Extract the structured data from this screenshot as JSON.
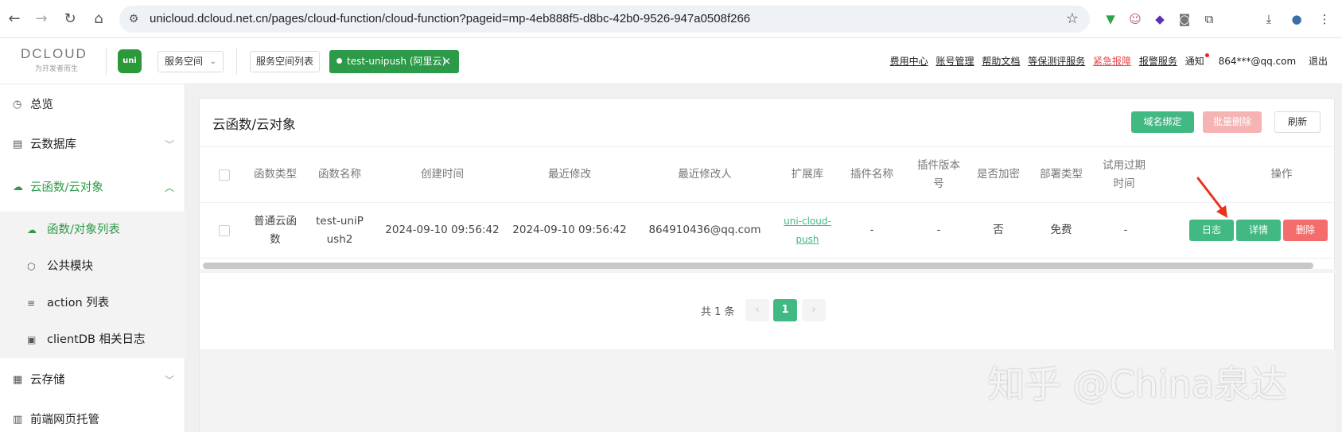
{
  "browser": {
    "url": "unicloud.dcloud.net.cn/pages/cloud-function/cloud-function?pageid=mp-4eb888f5-d8bc-42b0-9526-947a0508f266",
    "icons": [
      "back-icon",
      "forward-icon",
      "reload-icon",
      "home-icon",
      "site-info-icon",
      "star-icon",
      "extensions-icon",
      "download-icon",
      "profile-icon",
      "menu-icon"
    ]
  },
  "header": {
    "logo_text": "DCLOUD",
    "logo_sub": "为开发者而生",
    "uni_logo": "uni",
    "space_select": "服务空间",
    "space_list_btn": "服务空间列表",
    "active_space": "test-unipush (阿里云)",
    "links": {
      "fee": "费用中心",
      "account": "账号管理",
      "help": "帮助文档",
      "security": "等保测评服务",
      "emergency": "紧急报障",
      "alarm": "报警服务",
      "notice": "通知",
      "user": "864***@qq.com",
      "logout": "退出"
    }
  },
  "sidebar": {
    "overview": "总览",
    "database": "云数据库",
    "cloud_function": "云函数/云对象",
    "sub_items": [
      "函数/对象列表",
      "公共模块",
      "action 列表",
      "clientDB 相关日志"
    ],
    "storage": "云存储",
    "hosting": "前端网页托管"
  },
  "main": {
    "title": "云函数/云对象",
    "btn_domain": "域名绑定",
    "btn_batch_delete": "批量删除",
    "btn_refresh": "刷新",
    "columns": [
      "函数类型",
      "函数名称",
      "创建时间",
      "最近修改",
      "最近修改人",
      "扩展库",
      "插件名称",
      "插件版本号",
      "是否加密",
      "部署类型",
      "试用过期时间",
      "操作"
    ],
    "row": {
      "type": "普通云函数",
      "name": "test-uniPush2",
      "created": "2024-09-10 09:56:42",
      "modified": "2024-09-10 09:56:42",
      "modifier": "864910436@qq.com",
      "ext_lib": "uni-cloud-push",
      "plugin_name": "-",
      "plugin_version": "-",
      "encrypted": "否",
      "deploy_type": "免费",
      "trial_expire": "-",
      "btn_log": "日志",
      "btn_detail": "详情",
      "btn_delete": "删除"
    },
    "pagination": {
      "total": "共 1 条",
      "current": "1"
    }
  },
  "watermark": "知乎 @China泉达",
  "colors": {
    "primary_green": "#42b883",
    "header_green": "#2c9a48",
    "danger": "#f56c6c"
  }
}
